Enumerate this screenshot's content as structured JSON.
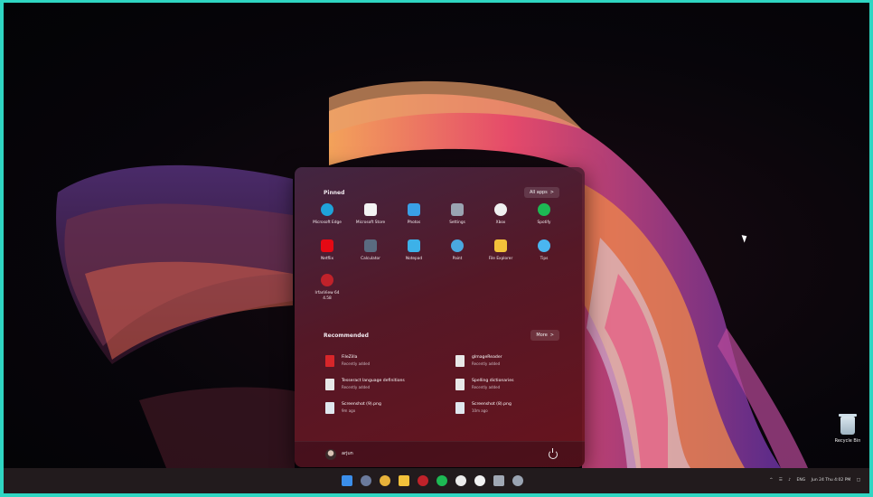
{
  "start_menu": {
    "pinned_title": "Pinned",
    "all_apps_label": "All apps",
    "all_apps_chevron": ">",
    "pinned": [
      {
        "label": "Microsoft Edge",
        "icon": "edge-icon",
        "color": "#1fa3d9"
      },
      {
        "label": "Microsoft Store",
        "icon": "store-icon",
        "color": "#f3f3f3"
      },
      {
        "label": "Photos",
        "icon": "photos-icon",
        "color": "#3aa0e6"
      },
      {
        "label": "Settings",
        "icon": "gear-icon",
        "color": "#9aa4b2"
      },
      {
        "label": "Xbox",
        "icon": "xbox-icon",
        "color": "#f0f0f0"
      },
      {
        "label": "Spotify",
        "icon": "spotify-icon",
        "color": "#1db954"
      },
      {
        "label": "Netflix",
        "icon": "netflix-icon",
        "color": "#e50914"
      },
      {
        "label": "Calculator",
        "icon": "calculator-icon",
        "color": "#5a6b80"
      },
      {
        "label": "Notepad",
        "icon": "notepad-icon",
        "color": "#3db1e8"
      },
      {
        "label": "Paint",
        "icon": "paint-icon",
        "color": "#4aa8e0"
      },
      {
        "label": "File Explorer",
        "icon": "folder-icon",
        "color": "#f2c13a"
      },
      {
        "label": "Tips",
        "icon": "lightbulb-icon",
        "color": "#4ab6f0"
      },
      {
        "label": "IrfanView 64\n4.58",
        "icon": "irfanview-icon",
        "color": "#c0222a"
      }
    ],
    "recommended_title": "Recommended",
    "more_label": "More",
    "more_chevron": ">",
    "recommended": [
      {
        "name": "FileZilla",
        "sub": "Recently added",
        "icon": "filezilla-icon",
        "color": "#d7262a"
      },
      {
        "name": "gImageReader",
        "sub": "Recently added",
        "icon": "document-icon",
        "color": "#e8e8e8"
      },
      {
        "name": "Tesseract language definitions",
        "sub": "Recently added",
        "icon": "document-icon",
        "color": "#e8e8e8"
      },
      {
        "name": "Spelling dictionaries",
        "sub": "Recently added",
        "icon": "document-icon",
        "color": "#e8e8e8"
      },
      {
        "name": "Screenshot (9).png",
        "sub": "9m ago",
        "icon": "image-file-icon",
        "color": "#dfe7ee"
      },
      {
        "name": "Screenshot (8).png",
        "sub": "10m ago",
        "icon": "image-file-icon",
        "color": "#dfe7ee"
      }
    ],
    "username": "arjun"
  },
  "desktop": {
    "recycle_bin_label": "Recycle Bin"
  },
  "taskbar": {
    "icons": [
      {
        "name": "start-icon",
        "color": "#3b8eea"
      },
      {
        "name": "search-icon",
        "color": "#6b7a9c"
      },
      {
        "name": "chrome-icon",
        "color": "#e8b23a"
      },
      {
        "name": "folder-icon",
        "color": "#f2c13a"
      },
      {
        "name": "irfanview-icon",
        "color": "#c0222a"
      },
      {
        "name": "spotify-icon",
        "color": "#1db954"
      },
      {
        "name": "chrome-alt-icon",
        "color": "#ececec"
      },
      {
        "name": "chat-icon",
        "color": "#f2f2f2"
      },
      {
        "name": "screen-icon",
        "color": "#a0a8b4"
      },
      {
        "name": "gear-icon",
        "color": "#9aa4b2"
      }
    ],
    "tray": {
      "chevron": "^",
      "language": "ENG",
      "datetime": "Jun 24 Thu 4:02 PM"
    }
  }
}
